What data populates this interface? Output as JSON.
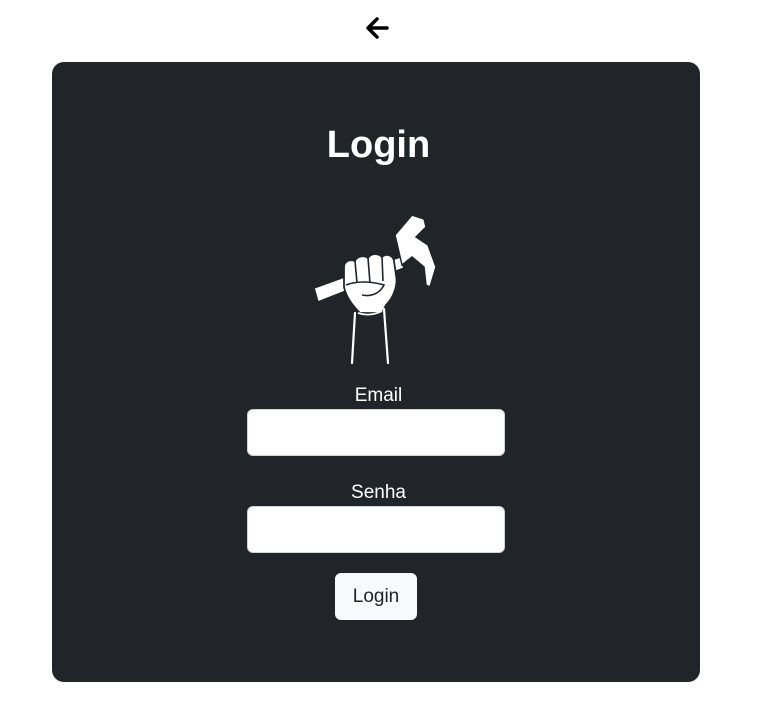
{
  "nav": {
    "back_icon": "arrow-left-icon"
  },
  "login_card": {
    "title": "Login",
    "logo_icon": "fist-hammer-icon",
    "email_label": "Email",
    "email_value": "",
    "password_label": "Senha",
    "password_value": "",
    "submit_label": "Login"
  },
  "colors": {
    "card_background": "#212529",
    "page_background": "#ffffff",
    "button_background": "#f8f9fa",
    "text_light": "#ffffff"
  }
}
